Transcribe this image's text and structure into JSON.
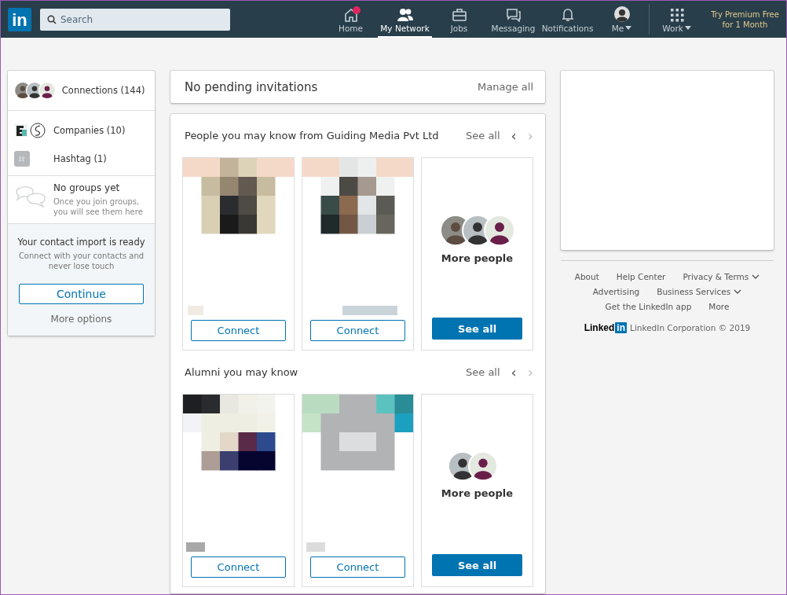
{
  "nav": {
    "logo": "in",
    "search": {
      "placeholder": "Search"
    },
    "items": [
      {
        "label": "Home",
        "selected": false,
        "notification": true,
        "caret": false
      },
      {
        "label": "My Network",
        "selected": true,
        "notification": false,
        "caret": false
      },
      {
        "label": "Jobs",
        "selected": false,
        "notification": false,
        "caret": false
      },
      {
        "label": "Messaging",
        "selected": false,
        "notification": false,
        "caret": false
      },
      {
        "label": "Notifications",
        "selected": false,
        "notification": false,
        "caret": false
      },
      {
        "label": "Me",
        "selected": false,
        "notification": false,
        "caret": true
      }
    ],
    "work": {
      "label": "Work"
    },
    "premium": [
      "Try Premium Free",
      "for 1 Month"
    ]
  },
  "sidebar": {
    "connections": "Connections (144)",
    "companies": "Companies (10)",
    "hashtag": "Hashtag (1)",
    "groups": {
      "title": "No groups yet",
      "text": "Once you join groups, you will see them here"
    },
    "import": {
      "title": "Your contact import is ready",
      "text": "Connect with your contacts and never lose touch",
      "button": "Continue",
      "link": "More options"
    }
  },
  "invitations": {
    "text": "No pending invitations",
    "link": "Manage all"
  },
  "sections": [
    {
      "title": "People you may know from Guiding Media Pvt Ltd",
      "see_all": "See all",
      "prev": "‹",
      "next": "›",
      "cards": [
        {
          "kind": "person",
          "action": "Connect"
        },
        {
          "kind": "person",
          "action": "Connect"
        },
        {
          "kind": "more",
          "title": "More people",
          "action": "See all"
        }
      ]
    },
    {
      "title": "Alumni you may know",
      "see_all": "See all",
      "prev": "‹",
      "next": "›",
      "cards": [
        {
          "kind": "person",
          "action": "Connect"
        },
        {
          "kind": "person",
          "action": "Connect"
        },
        {
          "kind": "more",
          "title": "More people",
          "action": "See all"
        }
      ]
    }
  ],
  "footer": {
    "links": [
      {
        "label": "About",
        "dropdown": false
      },
      {
        "label": "Help Center",
        "dropdown": false
      },
      {
        "label": "Privacy & Terms",
        "dropdown": true
      },
      {
        "label": "Advertising",
        "dropdown": false
      },
      {
        "label": "Business Services",
        "dropdown": true
      },
      {
        "label": "Get the LinkedIn app",
        "dropdown": false
      },
      {
        "label": "More",
        "dropdown": false
      }
    ],
    "brand": [
      "Linked",
      "in"
    ],
    "copyright": "LinkedIn Corporation © 2019"
  }
}
